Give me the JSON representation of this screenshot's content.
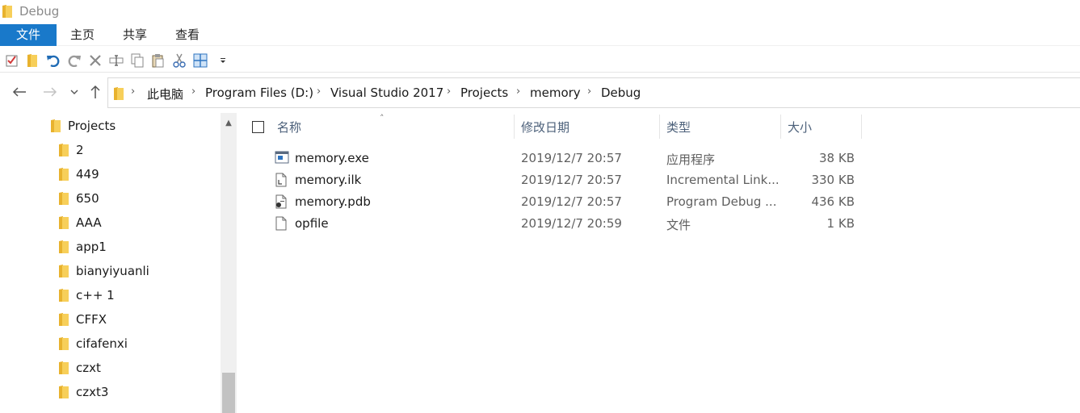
{
  "window": {
    "title": "Debug"
  },
  "ribbon": {
    "tabs": [
      "文件",
      "主页",
      "共享",
      "查看"
    ]
  },
  "quick_access": {
    "icons": [
      "properties-icon",
      "new-folder-icon",
      "undo-icon",
      "redo-icon",
      "delete-icon",
      "rename-icon",
      "copy-icon",
      "paste-icon",
      "cut-icon",
      "view-icon",
      "customize-dropdown-icon"
    ]
  },
  "navigation": {
    "back_icon": "back-arrow-icon",
    "forward_icon": "forward-arrow-icon",
    "recent_icon": "chevron-down-icon",
    "up_icon": "up-arrow-icon"
  },
  "address": {
    "breadcrumbs": [
      "此电脑",
      "Program Files (D:)",
      "Visual Studio 2017",
      "Projects",
      "memory",
      "Debug"
    ]
  },
  "nav_pane": {
    "root": "Projects",
    "items": [
      "2",
      "449",
      "650",
      "AAA",
      "app1",
      "bianyiyuanli",
      "c++ 1",
      "CFFX",
      "cifafenxi",
      "czxt",
      "czxt3"
    ]
  },
  "file_list": {
    "columns": {
      "name": "名称",
      "modified": "修改日期",
      "type": "类型",
      "size": "大小"
    },
    "rows": [
      {
        "name": "memory.exe",
        "modified": "2019/12/7 20:57",
        "type": "应用程序",
        "size": "38 KB",
        "icon": "exe-icon"
      },
      {
        "name": "memory.ilk",
        "modified": "2019/12/7 20:57",
        "type": "Incremental Link...",
        "size": "330 KB",
        "icon": "ilk-file-icon"
      },
      {
        "name": "memory.pdb",
        "modified": "2019/12/7 20:57",
        "type": "Program Debug ...",
        "size": "436 KB",
        "icon": "pdb-file-icon"
      },
      {
        "name": "opfile",
        "modified": "2019/12/7 20:59",
        "type": "文件",
        "size": "1 KB",
        "icon": "blank-file-icon"
      }
    ]
  },
  "colors": {
    "accent": "#1979ca",
    "folder": "#f5c542",
    "header_text": "#4c607a"
  }
}
